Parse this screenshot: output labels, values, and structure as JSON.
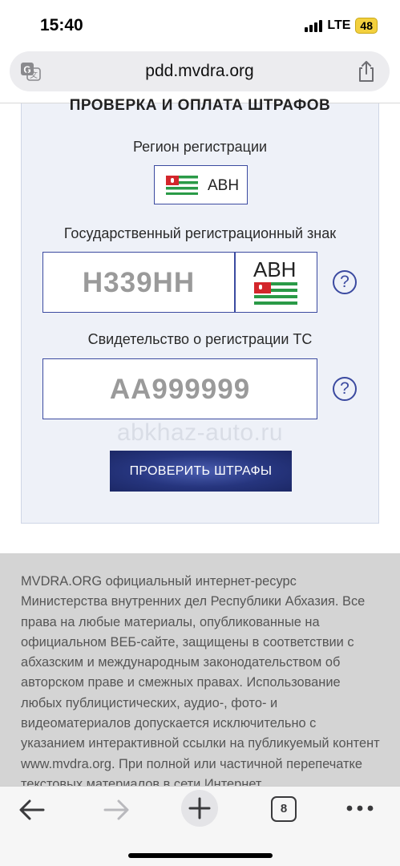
{
  "status_bar": {
    "time": "15:40",
    "network": "LTE",
    "battery": "48"
  },
  "browser": {
    "url": "pdd.mvdra.org",
    "tab_count": "8"
  },
  "form": {
    "title": "ПРОВЕРКА И ОПЛАТА ШТРАФОВ",
    "region_label": "Регион регистрации",
    "region_value": "АВН",
    "plate_label": "Государственный регистрационный знак",
    "plate_placeholder": "Н339НН",
    "plate_region": "АВН",
    "certificate_label": "Свидетельство о регистрации ТС",
    "certificate_placeholder": "АА999999",
    "help_symbol": "?",
    "submit_label": "ПРОВЕРИТЬ ШТРАФЫ"
  },
  "watermark": "abkhaz-auto.ru",
  "footer": {
    "text": "MVDRA.ORG официальный интернет-ресурс Министерства внутренних дел Республики Абхазия. Все права на любые материалы, опубликованные на официальном ВЕБ-сайте, защищены в соответствии с абхазским и международным законодательством об авторском праве и смежных правах. Использование любых публицистических, аудио-, фото- и видеоматериалов допускается исключительно с указанием интерактивной ссылки на публикуемый контент www.mvdra.org. При полной или частичной перепечатке текстовых материалов в сети Интернет"
  },
  "icons": {
    "translate": "translate-icon",
    "share": "share-icon",
    "back": "back-arrow-icon",
    "forward": "forward-arrow-icon",
    "new_tab": "plus-icon",
    "tabs": "tabs-icon",
    "more": "more-icon"
  },
  "colors": {
    "accent": "#3b4aa0",
    "button": "#26357e",
    "flag_green": "#2a9a47",
    "flag_red": "#d3262b",
    "battery": "#f3d03e"
  }
}
